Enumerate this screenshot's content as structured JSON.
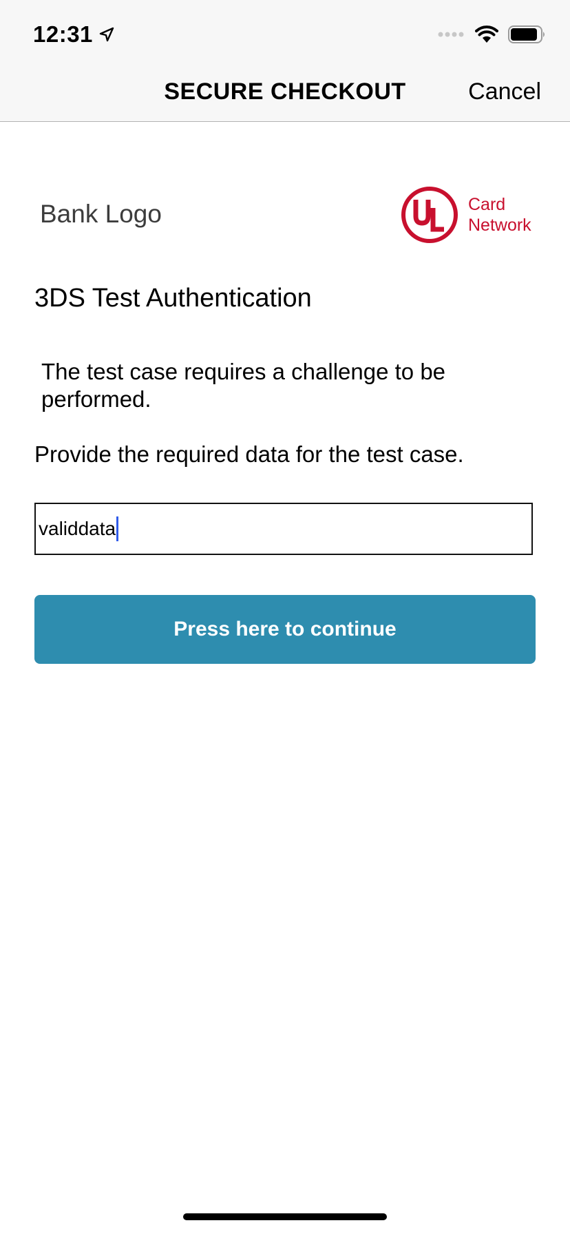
{
  "status_bar": {
    "time": "12:31",
    "icons": [
      "location-arrow-icon",
      "cellular-signal-icon",
      "wifi-icon",
      "battery-icon"
    ]
  },
  "nav": {
    "title": "SECURE CHECKOUT",
    "cancel_label": "Cancel"
  },
  "branding": {
    "bank_logo_text": "Bank Logo",
    "network_mark": "UL",
    "network_label_line1": "Card",
    "network_label_line2": "Network",
    "network_color": "#c8102e"
  },
  "content": {
    "heading": "3DS Test Authentication",
    "info_text": "The test case requires a challenge to be performed.",
    "prompt_text": "Provide the required data for the test case.",
    "input_value": "validdata",
    "button_label": "Press here to continue",
    "button_color": "#2e8daf",
    "caret_color": "#2f5bea"
  }
}
